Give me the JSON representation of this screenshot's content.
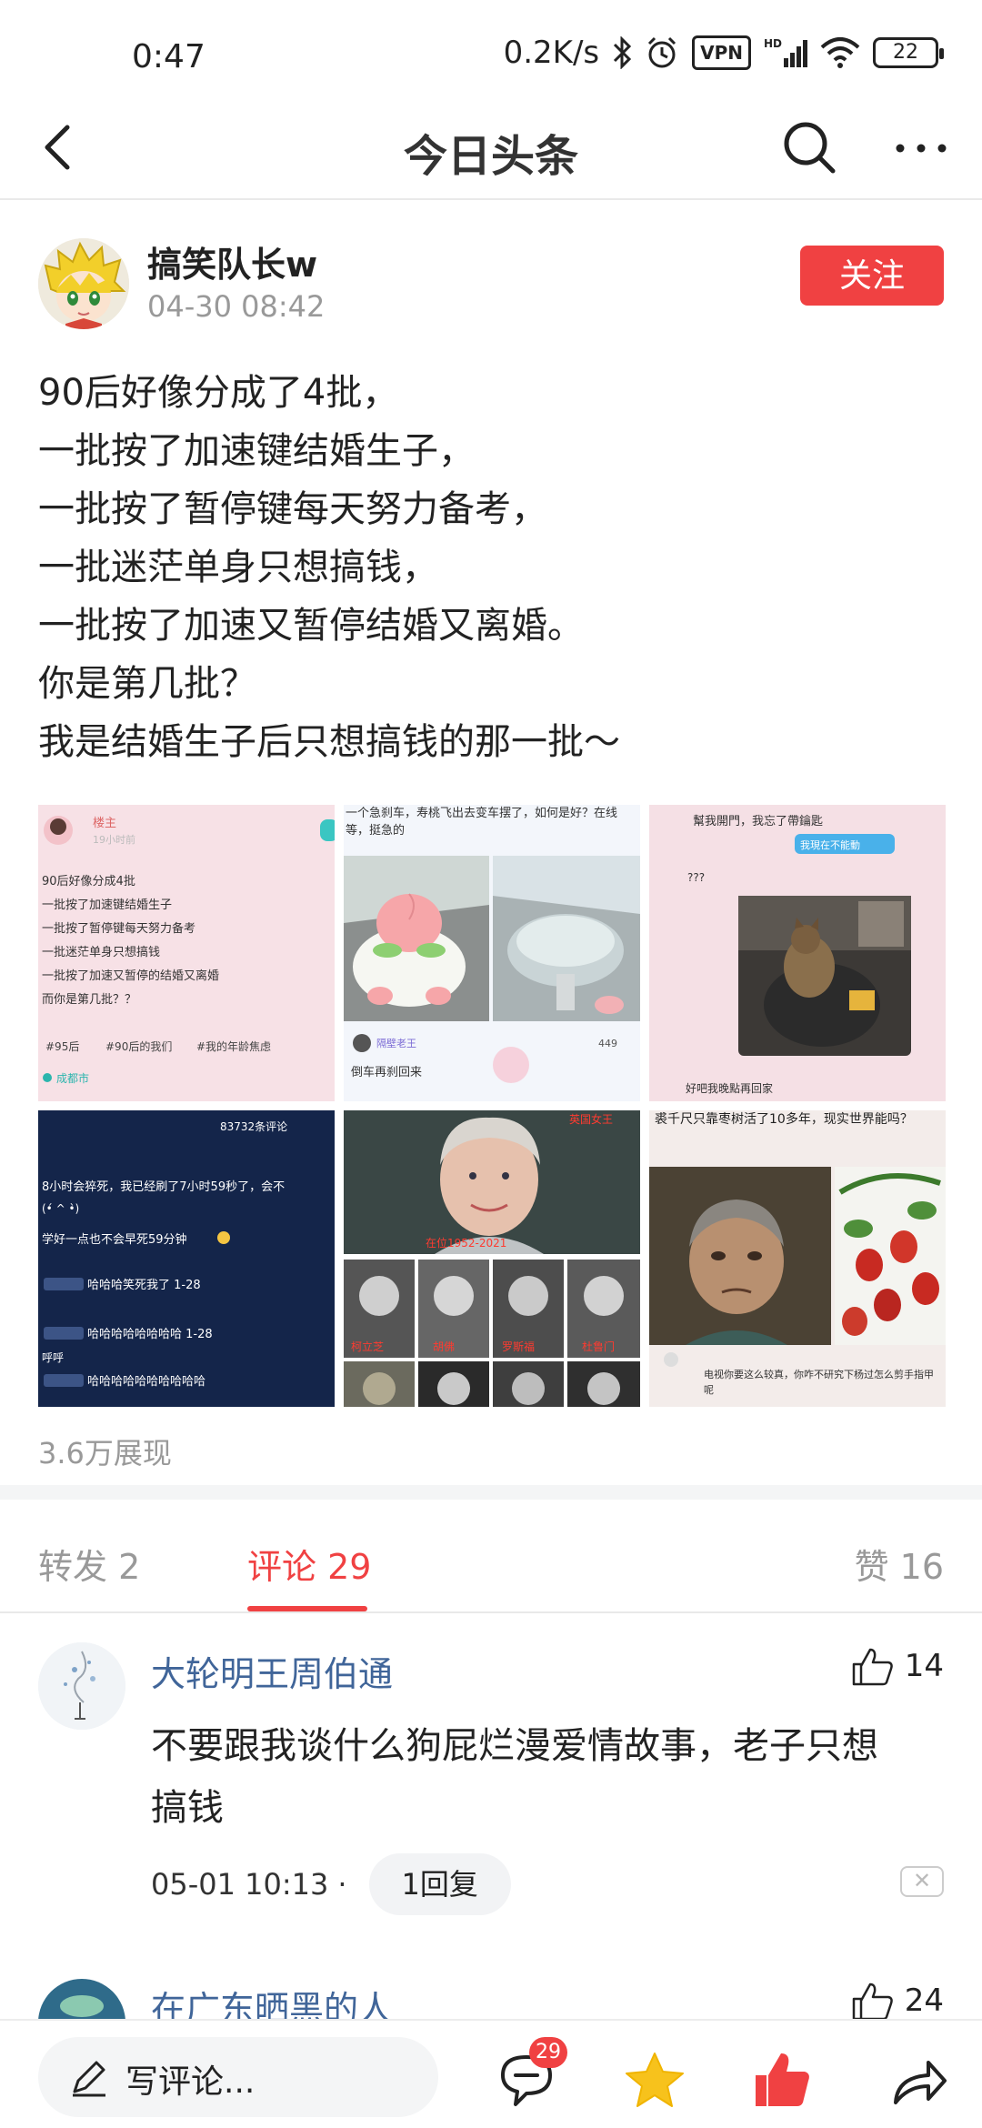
{
  "status_bar": {
    "time": "0:47",
    "speed": "0.2K/s",
    "vpn": "VPN",
    "hd": "HD",
    "battery": "22"
  },
  "header": {
    "title": "今日头条"
  },
  "post": {
    "author": "搞笑队长w",
    "time": "04-30 08:42",
    "follow_label": "关注",
    "lines": [
      "90后好像分成了4批，",
      "一批按了加速键结婚生子，",
      "一批按了暂停键每天努力备考，",
      "一批迷茫单身只想搞钱，",
      "一批按了加速又暂停结婚又离婚。",
      "你是第几批？",
      "我是结婚生子后只想搞钱的那一批～"
    ],
    "views": "3.6万展现",
    "images": {
      "img1": {
        "user": "楼主",
        "ago": "19小时前",
        "lines": [
          "90后好像分成4批",
          "一批按了加速键结婚生子",
          "一批按了暂停键每天努力备考",
          "一批迷茫单身只想搞钱",
          "一批按了加速又暂停的结婚又离婚",
          "而你是第几批？？"
        ],
        "tags": [
          "#95后",
          "#90后的我们",
          "#我的年龄焦虑"
        ],
        "location": "成都市"
      },
      "img2": {
        "caption": "一个急刹车，寿桃飞出去变车摆了，如何是好？在线等，挺急的",
        "user": "隔壁老王",
        "likes": "449",
        "reply": "倒车再刹回来"
      },
      "img3": {
        "top": "幫我開門，我忘了帶鑰匙",
        "bubble": "我現在不能動",
        "question": "???",
        "bottom": "好吧我晚點再回家"
      },
      "img4": {
        "count": "83732条评论",
        "line1": "8小时会猝死，我已经刷了7小时59秒了，会不",
        "line2": "学好一点也不会早死59分钟",
        "line3": "(•́ ^ •̀)",
        "line4": "哈哈哈笑死我了 1-28",
        "line5": "哈哈哈哈哈哈哈哈 1-28",
        "line6": "呼呼",
        "line7": "哈哈哈哈哈哈哈哈哈哈"
      },
      "img5": {
        "title": "英国女王",
        "years": "在位1952-2021",
        "names": [
          "柯立芝",
          "胡佛",
          "罗斯福",
          "杜鲁门"
        ]
      },
      "img6": {
        "caption": "裘千尺只靠枣树活了10多年，现实世界能吗？",
        "comment": "电视你要这么较真，你咋不研究下杨过怎么剪手指甲呢"
      }
    }
  },
  "tabs": {
    "forward": "转发 2",
    "comments": "评论 29",
    "likes": "赞 16"
  },
  "comments": [
    {
      "name": "大轮明王周伯通",
      "likes": "14",
      "text_line1": "不要跟我谈什么狗屁烂漫爱情故事，老子只想",
      "text_line2": "搞钱",
      "time": "05-01 10:13",
      "sep": "·",
      "replies": "1回复"
    },
    {
      "name": "在广东晒黑的人",
      "likes": "24"
    }
  ],
  "bottom_bar": {
    "write_placeholder": "写评论...",
    "comment_badge": "29"
  }
}
